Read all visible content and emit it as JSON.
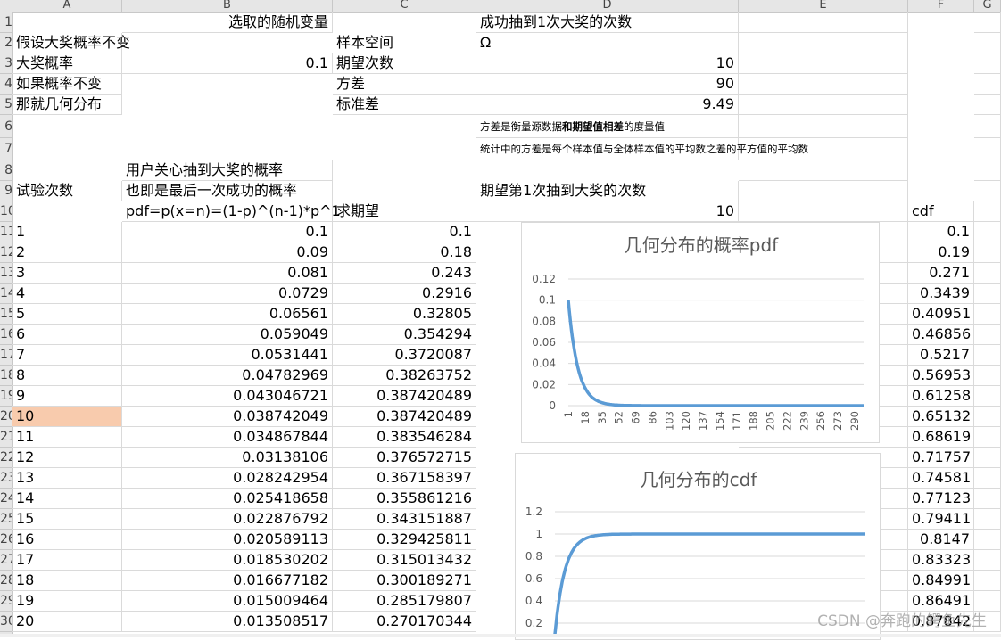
{
  "columns": [
    "A",
    "B",
    "C",
    "D",
    "E",
    "F",
    "G"
  ],
  "row_numbers": [
    "1",
    "2",
    "3",
    "4",
    "5",
    "6",
    "7",
    "8",
    "9",
    "10",
    "11",
    "12",
    "13",
    "14",
    "15",
    "16",
    "17",
    "18",
    "19",
    "20",
    "21",
    "22",
    "23",
    "24",
    "25",
    "26",
    "27",
    "28",
    "29",
    "30"
  ],
  "header_rows": {
    "r1": {
      "c": "选取的随机变量",
      "d": "成功抽到1次大奖的次数"
    },
    "r2": {
      "a": "假设大奖概率不变",
      "c": "样本空间",
      "d": "Ω"
    },
    "r3": {
      "a": "大奖概率",
      "b": "0.1",
      "c": "期望次数",
      "d": "10"
    },
    "r4": {
      "a": "如果概率不变",
      "c": "方差",
      "d": "90"
    },
    "r5": {
      "a": "那就几何分布",
      "c": "标准差",
      "d": "9.49"
    },
    "r6": {
      "d_pre": "方差是衡量源数据",
      "d_bold": "和期望值相差",
      "d_post": "的度量值"
    },
    "r7": {
      "d": "统计中的方差是每个样本值与全体样本值的平均数之差的平方值的平均数"
    },
    "r8": {
      "b": "用户关心抽到大奖的概率"
    },
    "r9": {
      "a": "试验次数",
      "b": "也即是最后一次成功的概率",
      "d": "期望第1次抽到大奖的次数"
    },
    "r10": {
      "b": "pdf=p(x=n)=(1-p)^(n-1)*p^1",
      "c": "求期望",
      "d": "10",
      "f": "cdf"
    }
  },
  "table_rows": [
    {
      "n": "1",
      "pdf": "0.1",
      "exp": "0.1",
      "cdf": "0.1"
    },
    {
      "n": "2",
      "pdf": "0.09",
      "exp": "0.18",
      "cdf": "0.19"
    },
    {
      "n": "3",
      "pdf": "0.081",
      "exp": "0.243",
      "cdf": "0.271"
    },
    {
      "n": "4",
      "pdf": "0.0729",
      "exp": "0.2916",
      "cdf": "0.3439"
    },
    {
      "n": "5",
      "pdf": "0.06561",
      "exp": "0.32805",
      "cdf": "0.40951"
    },
    {
      "n": "6",
      "pdf": "0.059049",
      "exp": "0.354294",
      "cdf": "0.46856"
    },
    {
      "n": "7",
      "pdf": "0.0531441",
      "exp": "0.3720087",
      "cdf": "0.5217"
    },
    {
      "n": "8",
      "pdf": "0.04782969",
      "exp": "0.38263752",
      "cdf": "0.56953"
    },
    {
      "n": "9",
      "pdf": "0.043046721",
      "exp": "0.387420489",
      "cdf": "0.61258"
    },
    {
      "n": "10",
      "pdf": "0.038742049",
      "exp": "0.387420489",
      "cdf": "0.65132"
    },
    {
      "n": "11",
      "pdf": "0.034867844",
      "exp": "0.383546284",
      "cdf": "0.68619"
    },
    {
      "n": "12",
      "pdf": "0.03138106",
      "exp": "0.376572715",
      "cdf": "0.71757"
    },
    {
      "n": "13",
      "pdf": "0.028242954",
      "exp": "0.367158397",
      "cdf": "0.74581"
    },
    {
      "n": "14",
      "pdf": "0.025418658",
      "exp": "0.355861216",
      "cdf": "0.77123"
    },
    {
      "n": "15",
      "pdf": "0.022876792",
      "exp": "0.343151887",
      "cdf": "0.79411"
    },
    {
      "n": "16",
      "pdf": "0.020589113",
      "exp": "0.329425811",
      "cdf": "0.8147"
    },
    {
      "n": "17",
      "pdf": "0.018530202",
      "exp": "0.315013432",
      "cdf": "0.83323"
    },
    {
      "n": "18",
      "pdf": "0.016677182",
      "exp": "0.300189271",
      "cdf": "0.84991"
    },
    {
      "n": "19",
      "pdf": "0.015009464",
      "exp": "0.285179807",
      "cdf": "0.86491"
    },
    {
      "n": "20",
      "pdf": "0.013508517",
      "exp": "0.270170344",
      "cdf": "0.87842"
    }
  ],
  "selected_row": 9,
  "colors": {
    "selection": "#f8cbad",
    "series": "#5b9bd5",
    "grid": "#d9d9d9"
  },
  "chart_data": [
    {
      "type": "line",
      "title": "几何分布的概率pdf",
      "ylim": [
        0,
        0.12
      ],
      "yticks": [
        "0.12",
        "0.1",
        "0.08",
        "0.06",
        "0.04",
        "0.02",
        "0"
      ],
      "xticks": [
        "1",
        "18",
        "35",
        "52",
        "69",
        "86",
        "103",
        "120",
        "137",
        "154",
        "171",
        "188",
        "205",
        "222",
        "239",
        "256",
        "273",
        "290"
      ],
      "x_range": [
        1,
        300
      ],
      "series": [
        {
          "formula": "pdf",
          "p": 0.1
        }
      ],
      "grid": true
    },
    {
      "type": "line",
      "title": "几何分布的cdf",
      "ylim": [
        0,
        1.2
      ],
      "yticks": [
        "1.2",
        "1",
        "0.8",
        "0.6",
        "0.4",
        "0.2"
      ],
      "x_range": [
        1,
        300
      ],
      "series": [
        {
          "formula": "cdf",
          "p": 0.1
        }
      ],
      "grid": true
    }
  ],
  "watermark": "CSDN @奔跑的鳄鱼先生"
}
